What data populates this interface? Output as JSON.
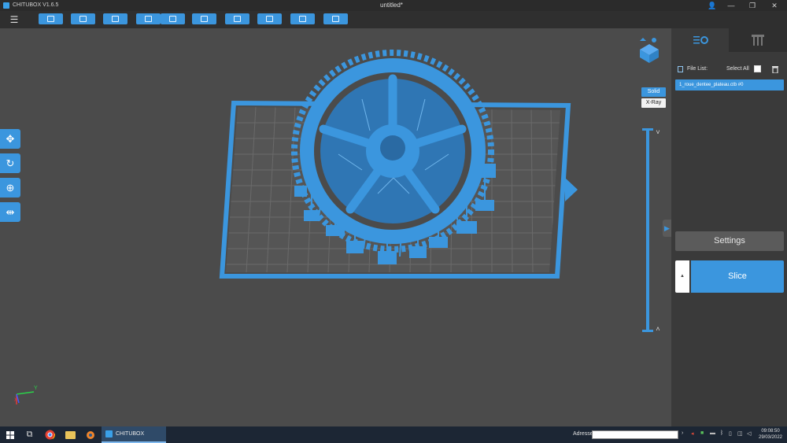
{
  "app": {
    "name": "CHITUBOX V1.6.5",
    "document_title": "untitled*"
  },
  "window_controls": {
    "account": "👤",
    "minimize": "—",
    "restore": "❐",
    "close": "✕"
  },
  "toolbar": {
    "menu_icon": "☰",
    "buttons": [
      "open-icon",
      "save-icon",
      "select-icon",
      "import-icon",
      "export-icon",
      "dialog-icon",
      "layout-icon",
      "support-icon",
      "hollow-icon",
      "lock-icon"
    ]
  },
  "view_mode": {
    "solid_label": "Solid",
    "xray_label": "X-Ray"
  },
  "left_tools": [
    {
      "name": "move-tool",
      "glyph": "✥"
    },
    {
      "name": "rotate-tool",
      "glyph": "↻"
    },
    {
      "name": "scale-tool",
      "glyph": "⊕"
    },
    {
      "name": "mirror-tool",
      "glyph": "⇹"
    }
  ],
  "layer_slider": {
    "up_arrow": "˅",
    "down_arrow": "˄"
  },
  "axis_gizmo": {
    "y_label": "Y",
    "x_label": "X"
  },
  "panel": {
    "tab_icons": [
      "file-list-tab-icon",
      "support-tab-icon"
    ],
    "file_list_label": "File List:",
    "select_all_label": "Select All",
    "files": [
      "1_roue_dentee_plateau.ctb #0"
    ],
    "settings_label": "Settings",
    "slice_label": "Slice",
    "slice_side_label": "▲",
    "collapse_arrow": "▶"
  },
  "taskbar": {
    "app_label": "CHITUBOX",
    "address_label": "Adresse",
    "address_value": "",
    "time": "09:08:50",
    "date": "29/03/2022"
  },
  "colors": {
    "accent": "#3b96de",
    "viewport": "#4b4b4b",
    "panel": "#3a3a3a"
  }
}
